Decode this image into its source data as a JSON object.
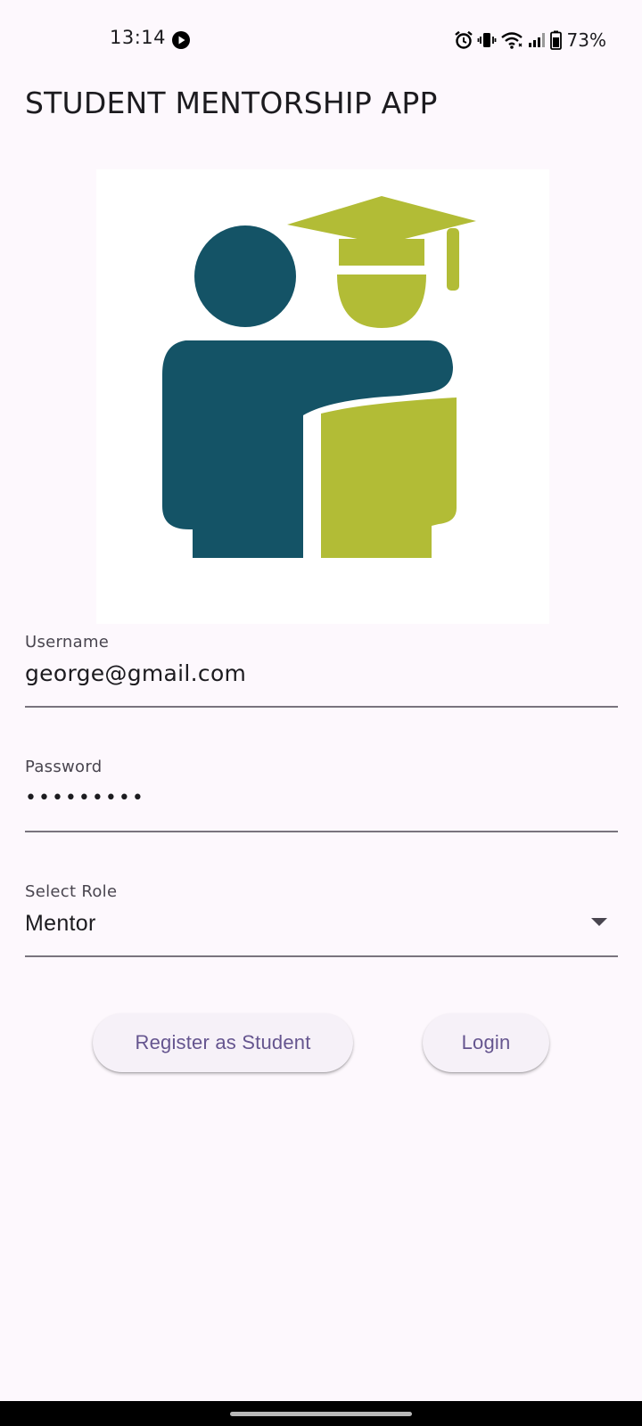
{
  "status_bar": {
    "time": "13:14",
    "battery": "73%",
    "icons": [
      "play-icon",
      "alarm-icon",
      "vibrate-icon",
      "wifi-icon",
      "signal-icon",
      "battery-icon"
    ]
  },
  "app": {
    "title": "STUDENT MENTORSHIP APP"
  },
  "logo": {
    "icon": "mentor-student-graduation-icon",
    "colors": {
      "mentor": "#145366",
      "student": "#b2bc36",
      "background": "#ffffff"
    }
  },
  "form": {
    "username": {
      "label": "Username",
      "value": "george@gmail.com"
    },
    "password": {
      "label": "Password",
      "value": "•••••••••"
    },
    "role": {
      "label": "Select Role",
      "value": "Mentor"
    }
  },
  "buttons": {
    "register_label": "Register as Student",
    "login_label": "Login"
  },
  "theme": {
    "background": "#fdf8fd",
    "accent": "#65558f",
    "button_background": "#f6f1f8",
    "underline": "#79747e"
  }
}
